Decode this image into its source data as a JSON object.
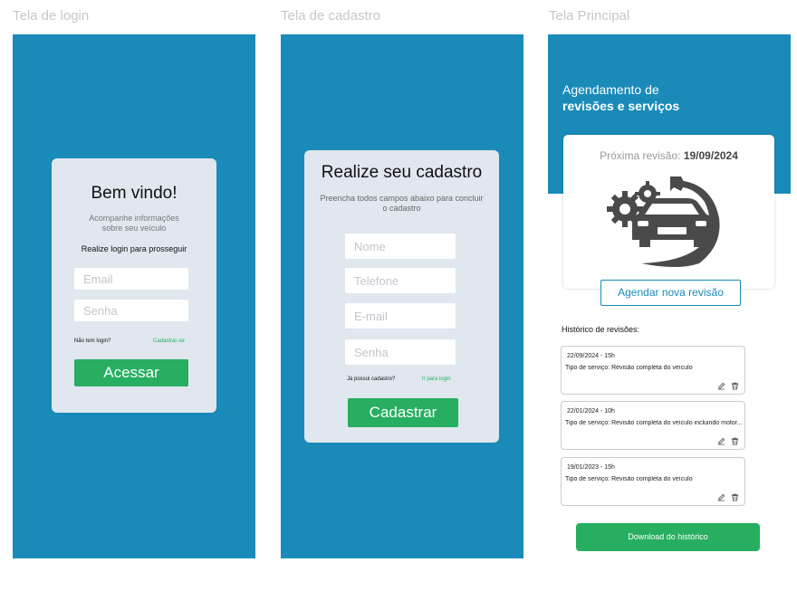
{
  "screens": {
    "login_title": "Tela de login",
    "cadastro_title": "Tela de cadastro",
    "principal_title": "Tela Principal"
  },
  "login": {
    "heading": "Bem vindo!",
    "subtitle": "Acompanhe informações sobre seu veículo",
    "prompt": "Realize login para prosseguir",
    "email_placeholder": "Email",
    "senha_placeholder": "Senha",
    "no_login": "Não tem login?",
    "register_link": "Cadastrar-se",
    "submit": "Acessar"
  },
  "cadastro": {
    "heading": "Realize seu cadastro",
    "subtitle": "Preencha todos campos abaixo para concluir o cadastro",
    "nome_placeholder": "Nome",
    "telefone_placeholder": "Telefone",
    "email_placeholder": "E-mail",
    "senha_placeholder": "Senha",
    "has_account": "Já possui cadastro?",
    "login_link": "Ir para login",
    "submit": "Cadastrar"
  },
  "principal": {
    "header_line1": "Agendamento de",
    "header_line2": "revisões e serviços",
    "next_label": "Próxima revisão:",
    "next_date": "19/09/2024",
    "schedule_button": "Agendar nova revisão",
    "history_title": "Histórico de revisões:",
    "history": [
      {
        "date": "22/09/2024 - 15h",
        "desc": "Tipo de serviço: Revisão completa do veículo"
      },
      {
        "date": "22/01/2024 - 10h",
        "desc": "Tipo de serviço: Revisão completa do veículo incluindo motor..."
      },
      {
        "date": "19/01/2023 - 15h",
        "desc": "Tipo de serviço: Revisão completa do veículo"
      }
    ],
    "download_button": "Download do histórico"
  },
  "colors": {
    "brand_blue": "#1a8bb9",
    "card_gray": "#e0e7ee",
    "green": "#27ae60",
    "car_gray": "#4a4a4a"
  },
  "icons": [
    "gear-icon",
    "wrench-icon",
    "car-icon",
    "edit-icon",
    "trash-icon"
  ]
}
